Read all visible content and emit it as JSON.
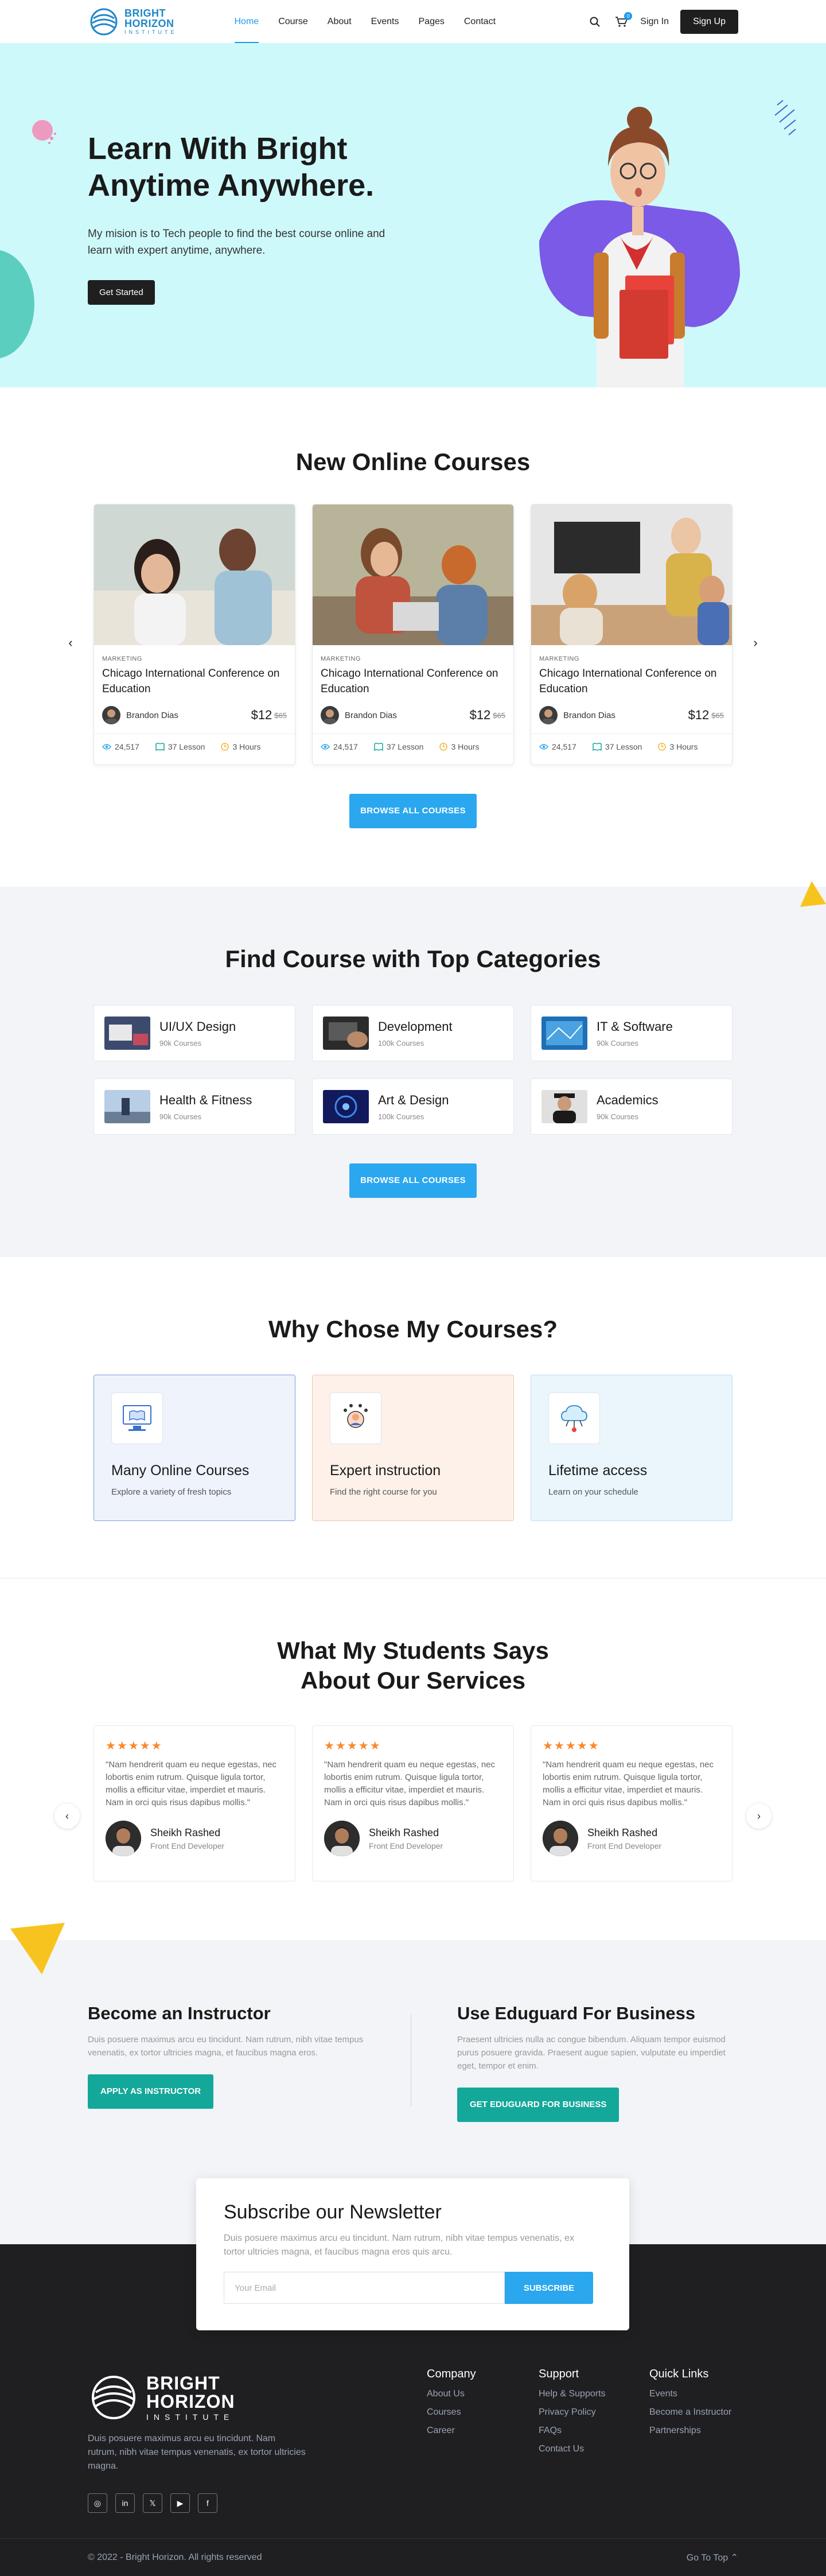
{
  "brand": {
    "line1": "BRIGHT",
    "line2": "HORIZON",
    "line3": "INSTITUTE"
  },
  "nav": {
    "items": [
      "Home",
      "Course",
      "About",
      "Events",
      "Pages",
      "Contact"
    ],
    "cart_count": "0",
    "signin": "Sign In",
    "signup": "Sign Up"
  },
  "hero": {
    "title_line1": "Learn With Bright",
    "title_line2": "Anytime Anywhere.",
    "subtitle": "My mision is to Tech people to find the best course online and learn with expert anytime, anywhere.",
    "cta": "Get Started"
  },
  "courses": {
    "title": "New Online Courses",
    "cta": "BROWSE ALL COURSES",
    "items": [
      {
        "category": "MARKETING",
        "title": "Chicago International Conference on Education",
        "author": "Brandon Dias",
        "price": "$12",
        "old_price": "$65",
        "views": "24,517",
        "lessons": "37 Lesson",
        "hours": "3 Hours"
      },
      {
        "category": "MARKETING",
        "title": "Chicago International Conference on Education",
        "author": "Brandon Dias",
        "price": "$12",
        "old_price": "$65",
        "views": "24,517",
        "lessons": "37 Lesson",
        "hours": "3 Hours"
      },
      {
        "category": "MARKETING",
        "title": "Chicago International Conference on Education",
        "author": "Brandon Dias",
        "price": "$12",
        "old_price": "$65",
        "views": "24,517",
        "lessons": "37 Lesson",
        "hours": "3 Hours"
      }
    ]
  },
  "categories": {
    "title": "Find Course with Top Categories",
    "cta": "BROWSE ALL COURSES",
    "items": [
      {
        "name": "UI/UX Design",
        "count": "90k Courses"
      },
      {
        "name": "Development",
        "count": "100k Courses"
      },
      {
        "name": "IT & Software",
        "count": "90k Courses"
      },
      {
        "name": "Health & Fitness",
        "count": "90k Courses"
      },
      {
        "name": "Art & Design",
        "count": "100k Courses"
      },
      {
        "name": "Academics",
        "count": "90k Courses"
      }
    ]
  },
  "why": {
    "title": "Why Chose My Courses?",
    "items": [
      {
        "title": "Many Online Courses",
        "desc": "Explore a variety of fresh topics"
      },
      {
        "title": "Expert instruction",
        "desc": "Find the right course for you"
      },
      {
        "title": "Lifetime access",
        "desc": "Learn on your schedule"
      }
    ]
  },
  "testimonials": {
    "title_line1": "What My Students Says",
    "title_line2": "About Our Services",
    "items": [
      {
        "stars": "★★★★★",
        "text": "\"Nam hendrerit quam eu neque egestas, nec lobortis enim rutrum. Quisque ligula tortor, mollis a efficitur vitae, imperdiet et mauris. Nam in orci quis risus dapibus mollis.\"",
        "name": "Sheikh Rashed",
        "role": "Front End Developer"
      },
      {
        "stars": "★★★★★",
        "text": "\"Nam hendrerit quam eu neque egestas, nec lobortis enim rutrum. Quisque ligula tortor, mollis a efficitur vitae, imperdiet et mauris. Nam in orci quis risus dapibus mollis.\"",
        "name": "Sheikh Rashed",
        "role": "Front End Developer"
      },
      {
        "stars": "★★★★★",
        "text": "\"Nam hendrerit quam eu neque egestas, nec lobortis enim rutrum. Quisque ligula tortor, mollis a efficitur vitae, imperdiet et mauris. Nam in orci quis risus dapibus mollis.\"",
        "name": "Sheikh Rashed",
        "role": "Front End Developer"
      }
    ]
  },
  "instructor": {
    "left": {
      "title": "Become an Instructor",
      "text": "Duis posuere maximus arcu eu tincidunt. Nam rutrum, nibh vitae tempus venenatis, ex tortor ultricies magna, et faucibus magna eros.",
      "cta": "APPLY AS INSTRUCTOR"
    },
    "right": {
      "title": "Use Eduguard For Business",
      "text": "Praesent ultricies nulla ac congue bibendum. Aliquam tempor euismod purus posuere gravida. Praesent augue sapien, vulputate eu imperdiet eget, tempor et enim.",
      "cta": "GET EDUGUARD FOR BUSINESS"
    }
  },
  "newsletter": {
    "title": "Subscribe our Newsletter",
    "text": "Duis posuere maximus arcu eu tincidunt. Nam rutrum, nibh vitae tempus venenatis, ex tortor ultricies magna, et faucibus magna eros quis arcu.",
    "placeholder": "Your Email",
    "cta": "SUBSCRIBE"
  },
  "footer": {
    "desc": "Duis posuere maximus arcu eu tincidunt. Nam rutrum, nibh vitae tempus venenatis, ex tortor ultricies magna.",
    "company": {
      "title": "Company",
      "links": [
        "About Us",
        "Courses",
        "Career"
      ]
    },
    "support": {
      "title": "Support",
      "links": [
        "Help & Supports",
        "Privacy Policy",
        "FAQs",
        "Contact Us"
      ]
    },
    "quick": {
      "title": "Quick Links",
      "links": [
        "Events",
        "Become a Instructor",
        "Partnerships"
      ]
    },
    "copyright": "© 2022 - Bright Horizon. All rights reserved",
    "to_top": "Go To Top ⌃"
  },
  "colors": {
    "accent": "#2aa7ee",
    "hero_bg": "#cef9fb",
    "green": "#14a89a",
    "star": "#f7892b",
    "dark": "#1f1f22"
  }
}
